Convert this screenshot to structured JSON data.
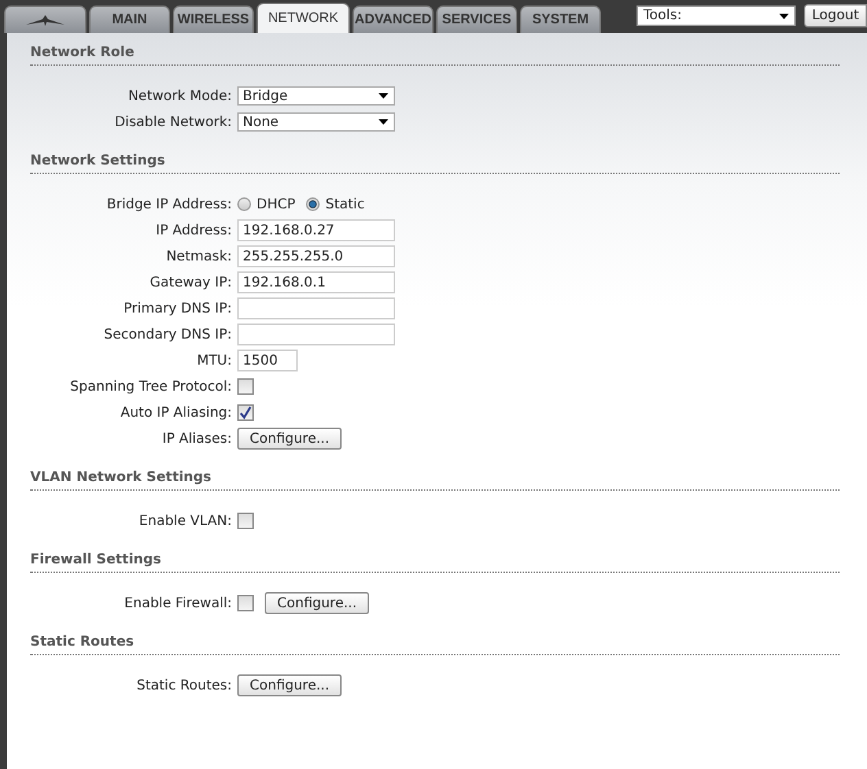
{
  "tabs": [
    {
      "label": "MAIN",
      "selected": false
    },
    {
      "label": "WIRELESS",
      "selected": false
    },
    {
      "label": "NETWORK",
      "selected": true
    },
    {
      "label": "ADVANCED",
      "selected": false
    },
    {
      "label": "SERVICES",
      "selected": false
    },
    {
      "label": "SYSTEM",
      "selected": false
    }
  ],
  "tools": {
    "value": "Tools:"
  },
  "logout": "Logout",
  "sections": [
    {
      "title": "Network Role",
      "rows": [
        {
          "label": "Network Mode:",
          "controls": [
            {
              "kind": "select",
              "value": "Bridge"
            }
          ]
        },
        {
          "label": "Disable Network:",
          "controls": [
            {
              "kind": "select",
              "value": "None"
            }
          ]
        }
      ]
    },
    {
      "title": "Network Settings",
      "rows": [
        {
          "label": "Bridge IP Address:",
          "controls": [
            {
              "kind": "radio",
              "label": "DHCP",
              "selected": false
            },
            {
              "kind": "radio",
              "label": "Static",
              "selected": true
            }
          ]
        },
        {
          "label": "IP Address:",
          "controls": [
            {
              "kind": "text",
              "value": "192.168.0.27"
            }
          ]
        },
        {
          "label": "Netmask:",
          "controls": [
            {
              "kind": "text",
              "value": "255.255.255.0"
            }
          ]
        },
        {
          "label": "Gateway IP:",
          "controls": [
            {
              "kind": "text",
              "value": "192.168.0.1"
            }
          ]
        },
        {
          "label": "Primary DNS IP:",
          "controls": [
            {
              "kind": "text"
            }
          ]
        },
        {
          "label": "Secondary DNS IP:",
          "controls": [
            {
              "kind": "text"
            }
          ]
        },
        {
          "label": "MTU:",
          "controls": [
            {
              "kind": "short-text",
              "value": "1500"
            }
          ]
        },
        {
          "label": "Spanning Tree Protocol:",
          "controls": [
            {
              "kind": "checkbox",
              "checked": false
            }
          ]
        },
        {
          "label": "Auto IP Aliasing:",
          "controls": [
            {
              "kind": "checkbox",
              "checked": true
            }
          ]
        },
        {
          "label": "IP Aliases:",
          "controls": [
            {
              "kind": "button",
              "label": "Configure..."
            }
          ]
        }
      ]
    },
    {
      "title": "VLAN Network Settings",
      "rows": [
        {
          "label": "Enable VLAN:",
          "controls": [
            {
              "kind": "checkbox",
              "checked": false
            }
          ]
        }
      ]
    },
    {
      "title": "Firewall Settings",
      "rows": [
        {
          "label": "Enable Firewall:",
          "controls": [
            {
              "kind": "checkbox",
              "checked": false
            },
            {
              "kind": "button",
              "label": "Configure..."
            }
          ]
        }
      ]
    },
    {
      "title": "Static Routes",
      "rows": [
        {
          "label": "Static Routes:",
          "controls": [
            {
              "kind": "button",
              "label": "Configure..."
            }
          ]
        }
      ]
    }
  ]
}
